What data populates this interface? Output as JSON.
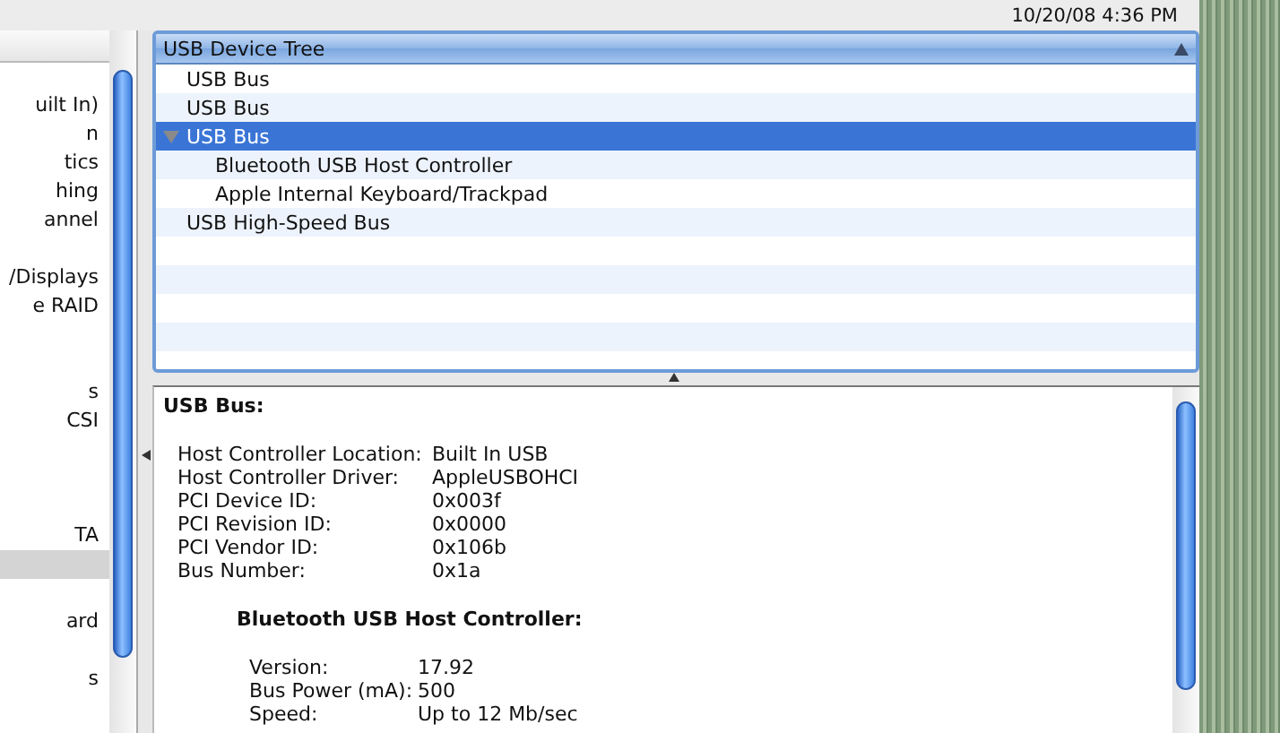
{
  "status_bar": {
    "datetime": "10/20/08 4:36 PM"
  },
  "sidebar": {
    "items": [
      {
        "selected": false
      },
      {
        "label": "uilt In)",
        "selected": false
      },
      {
        "label": "n",
        "selected": false
      },
      {
        "label": "tics",
        "selected": false
      },
      {
        "label": "hing",
        "selected": false
      },
      {
        "label": "annel",
        "selected": false
      },
      {
        "selected": false
      },
      {
        "label": "/Displays",
        "selected": false
      },
      {
        "label": "e RAID",
        "selected": false
      },
      {
        "selected": false
      },
      {
        "selected": false
      },
      {
        "label": "s",
        "selected": false
      },
      {
        "label": "CSI",
        "selected": false
      },
      {
        "selected": false
      },
      {
        "selected": false
      },
      {
        "selected": false
      },
      {
        "label": "TA",
        "selected": false
      },
      {
        "selected": true
      },
      {
        "selected": false
      },
      {
        "label": "ard",
        "selected": false
      },
      {
        "selected": false
      },
      {
        "label": "s",
        "selected": false
      }
    ]
  },
  "tree": {
    "title": "USB Device Tree",
    "rows": [
      {
        "label": "USB Bus",
        "selected": false
      },
      {
        "label": "USB Bus",
        "selected": false
      },
      {
        "label": "USB Bus",
        "selected": true,
        "expanded": true,
        "children": [
          {
            "label": "Bluetooth USB Host Controller",
            "selected": false
          },
          {
            "label": "Apple Internal Keyboard/Trackpad",
            "selected": false
          }
        ]
      },
      {
        "label": "USB High-Speed Bus",
        "selected": false
      }
    ]
  },
  "details": {
    "title": "USB Bus:",
    "fields": [
      {
        "label": "Host Controller Location:",
        "value": "Built In USB"
      },
      {
        "label": "Host Controller Driver:",
        "value": "AppleUSBOHCI"
      },
      {
        "label": "PCI Device ID:",
        "value": "0x003f"
      },
      {
        "label": "PCI Revision ID:",
        "value": "0x0000"
      },
      {
        "label": "PCI Vendor ID:",
        "value": "0x106b"
      },
      {
        "label": "Bus Number:",
        "value": "0x1a"
      }
    ],
    "subsection": {
      "title": "Bluetooth USB Host Controller:",
      "fields": [
        {
          "label": "Version:",
          "value": "17.92"
        },
        {
          "label": "Bus Power (mA):",
          "value": "500"
        },
        {
          "label": "Speed:",
          "value": "Up to 12 Mb/sec"
        }
      ]
    }
  }
}
